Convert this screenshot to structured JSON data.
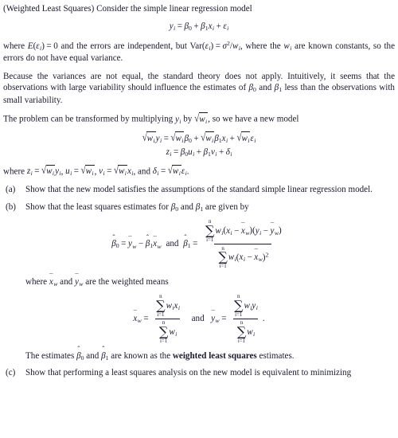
{
  "document": {
    "type": "textbook-exercise",
    "topic": "Weighted Least Squares",
    "intro": {
      "prefix": "(Weighted Least Squares)",
      "text": " Consider the simple linear regression model"
    },
    "eq_model": {
      "lhs": "y_i",
      "rhs": "beta_0 + beta_1 x_i + epsilon_i",
      "parts": {
        "y": "y",
        "eq": "=",
        "b": "β",
        "zero": "0",
        "one": "1",
        "x": "x",
        "eps": "ε",
        "plus": "+",
        "i": "i"
      }
    },
    "para_where_var": {
      "s1": "where ",
      "E": "E",
      "s2": " and the errors are independent, but ",
      "Var": "Var",
      "sigma": "σ",
      "s3": " are known constants, so the errors do not have equal variance.",
      "zero": "0",
      "w": "w",
      "eps": "ε",
      "i": "i",
      "two": "2",
      "slash": "/",
      "comma_where_the": ", where the "
    },
    "para_because": {
      "s1": "Because the variances are not equal, the standard theory does not apply. Intuitively, it seems that the observations with large variability should influence the estimates of ",
      "beta": "β",
      "zero": "0",
      "one": "1",
      "and": " and ",
      "s2": " less than the observations with small variability."
    },
    "para_transform": {
      "s1": "The problem can be transformed by multiplying ",
      "y": "y",
      "i": "i",
      "s2": " by ",
      "w": "w",
      "s3": ", so we have a new model"
    },
    "eq_transformed": {
      "line1": "sqrt(w_i) y_i = sqrt(w_i) beta_0 + sqrt(w_i) beta_1 x_i + sqrt(w_i) epsilon_i",
      "line2": "z_i = beta_0 u_i + beta_1 v_i + delta_i",
      "glyphs": {
        "z": "z",
        "u": "u",
        "v": "v",
        "delta": "δ",
        "beta": "β",
        "w": "w",
        "y": "y",
        "x": "x",
        "eps": "ε",
        "i": "i",
        "eq": "=",
        "plus": "+",
        "zero": "0",
        "one": "1"
      }
    },
    "para_defs": {
      "s1": "where ",
      "comma": ", ",
      "and": ", and ",
      "period": "."
    },
    "items": [
      {
        "marker": "(a)",
        "text": "Show that the new model satisfies the assumptions of the standard simple linear regression model."
      },
      {
        "marker": "(b)",
        "text_before": "Show that the least squares estimates for ",
        "text_mid": " and ",
        "text_after": " are given by"
      },
      {
        "marker": "(c)",
        "text": "Show that performing a least squares analysis on the new model is equivalent to minimizing"
      }
    ],
    "eq_estimates": {
      "beta0_hat": "beta_0_hat = ybar_w - beta_1_hat xbar_w",
      "and": "and",
      "beta1_hat_num": "sum_{i=1}^{n} w_i (x_i - xbar_w)(y_i - ybar_w)",
      "beta1_hat_den": "sum_{i=1}^{n} w_i (x_i - xbar_w)^2",
      "hat": "ˆ",
      "bar": "¯",
      "sum": "∑",
      "n": "n",
      "ilow": "i=1",
      "minus": "−",
      "two": "2"
    },
    "para_weighted_means": {
      "s1": "where ",
      "and": " and ",
      "s2": " are the weighted means"
    },
    "eq_weighted_means": {
      "xbar_num": "sum_{i=1}^{n} w_i x_i",
      "xbar_den": "sum_{i=1}^{n} w_i",
      "and": "and",
      "ybar_num": "sum_{i=1}^{n} w_i y_i",
      "ybar_den": "sum_{i=1}^{n} w_i",
      "period": "."
    },
    "para_estimates_known": {
      "s1": "The estimates ",
      "and": " and ",
      "s2": " are known as the ",
      "bold_term": "weighted least squares",
      "s3": " estimates."
    }
  },
  "style": {
    "text_color": "#1a1a2e",
    "background": "#ffffff"
  }
}
